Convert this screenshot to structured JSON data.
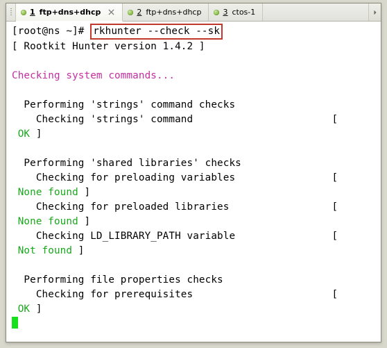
{
  "tabs": [
    {
      "num": "1",
      "label": "ftp+dns+dhcp",
      "active": true,
      "closable": true
    },
    {
      "num": "2",
      "label": "ftp+dns+dhcp",
      "active": false,
      "closable": false
    },
    {
      "num": "3",
      "label": "ctos-1",
      "active": false,
      "closable": false
    }
  ],
  "prompt": {
    "text": "[root@ns ~]# ",
    "cmd": "rkhunter --check --sk"
  },
  "lines": {
    "version": "[ Rootkit Hunter version 1.4.2 ]",
    "section": "Checking system commands...",
    "perf1": "  Performing 'strings' command checks",
    "chk1": "    Checking 'strings' command                       [",
    "ok1": " OK",
    "close": " ]",
    "perf2": "  Performing 'shared libraries' checks",
    "chk2a": "    Checking for preloading variables                [",
    "nf": " None found",
    "chk2b": "    Checking for preloaded libraries                 [",
    "chk2c": "    Checking LD_LIBRARY_PATH variable                [",
    "notf": " Not found",
    "perf3": "  Performing file properties checks",
    "chk3": "    Checking for prerequisites                       [",
    "ok2": " OK"
  }
}
